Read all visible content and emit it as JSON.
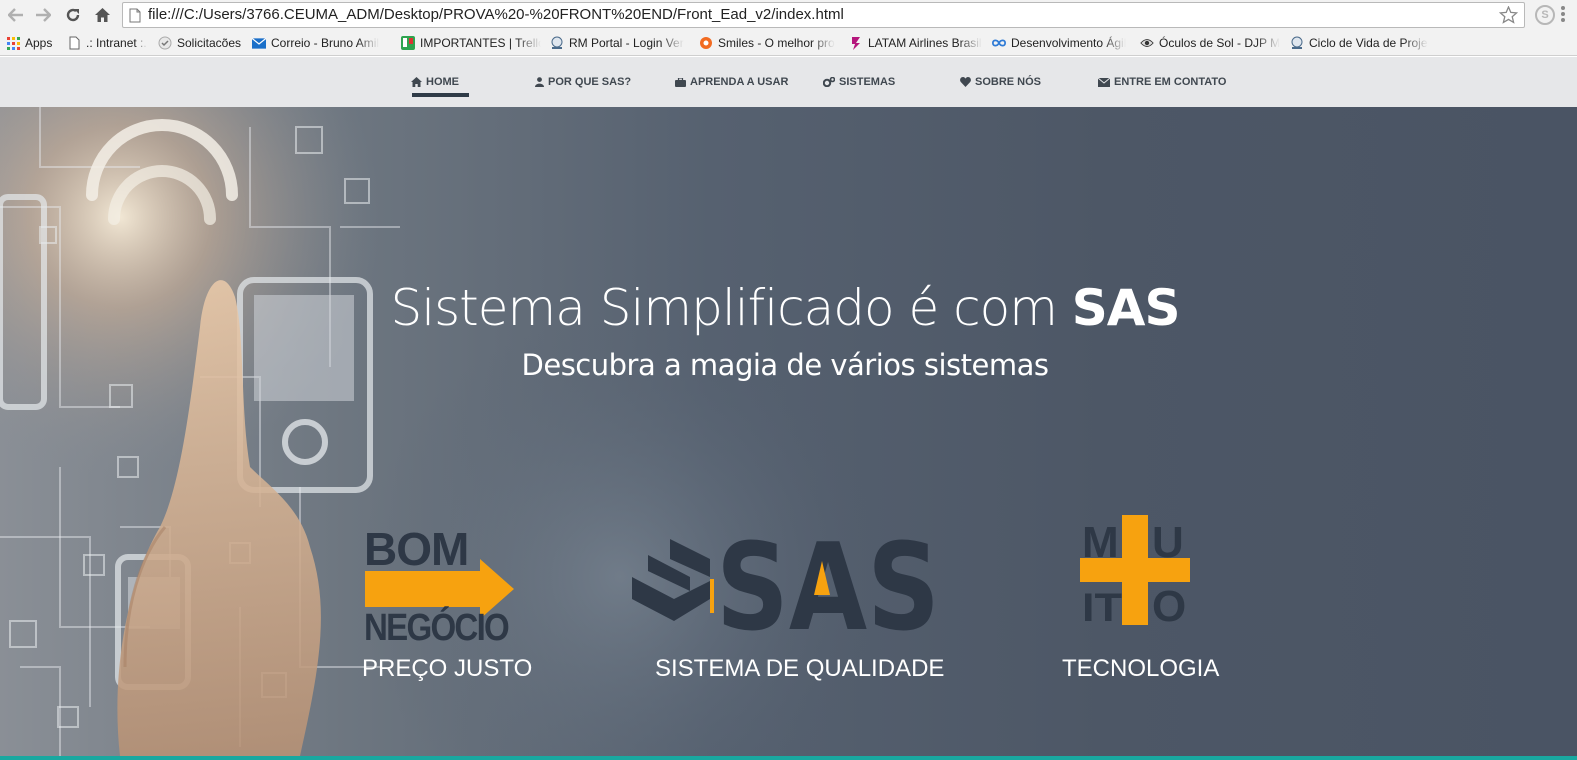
{
  "browser": {
    "url": "file:///C:/Users/3766.CEUMA_ADM/Desktop/PROVA%20-%20FRONT%20END/Front_Ead_v2/index.html",
    "skype_icon": "S",
    "bookmarks": [
      {
        "label": "Apps",
        "icon": "apps-grid-icon"
      },
      {
        "label": ".: Intranet :.",
        "icon": "page-icon"
      },
      {
        "label": "Solicitacões",
        "icon": "solicitacoes-icon"
      },
      {
        "label": "Correio - Bruno Amil",
        "icon": "mail-icon"
      },
      {
        "label": "IMPORTANTES | Trello",
        "icon": "trello-icon"
      },
      {
        "label": "RM Portal - Login Ver",
        "icon": "rm-portal-icon"
      },
      {
        "label": "Smiles - O melhor pro",
        "icon": "smiles-icon"
      },
      {
        "label": "LATAM Airlines Brasil",
        "icon": "latam-icon"
      },
      {
        "label": "Desenvolvimento Ágil",
        "icon": "infinity-icon"
      },
      {
        "label": "Óculos de Sol - DJP M",
        "icon": "eye-icon"
      },
      {
        "label": "Ciclo de Vida de Proje",
        "icon": "ceuma-icon"
      }
    ]
  },
  "nav": {
    "items": [
      {
        "label": "HOME",
        "icon": "home-icon",
        "active": true
      },
      {
        "label": "POR QUE SAS?",
        "icon": "user-icon"
      },
      {
        "label": "APRENDA A USAR",
        "icon": "briefcase-icon"
      },
      {
        "label": "SISTEMAS",
        "icon": "gears-icon"
      },
      {
        "label": "SOBRE NÓS",
        "icon": "heart-icon"
      },
      {
        "label": "ENTRE EM CONTATO",
        "icon": "envelope-icon"
      }
    ]
  },
  "hero": {
    "title_light": "Sistema Simplificado é com ",
    "title_bold": "SAS",
    "subtitle": "Descubra a magia de vários sistemas"
  },
  "features": [
    {
      "logo_top": "BOM",
      "logo_bottom": "NEGÓCIO",
      "label": "PREÇO JUSTO"
    },
    {
      "logo": "SAS",
      "label": "SISTEMA DE QUALIDADE"
    },
    {
      "logo_top_left": "M",
      "logo_top_right": "U",
      "logo_bottom_left": "IT",
      "logo_bottom_right": "O",
      "label": "TECNOLOGIA"
    }
  ],
  "colors": {
    "accent_orange": "#f7a20f",
    "logo_dark": "#2e3846",
    "nav_bg": "#e6e7e9",
    "hero_bg": "#4f5a69",
    "bottom_bar": "#19a8a0"
  }
}
